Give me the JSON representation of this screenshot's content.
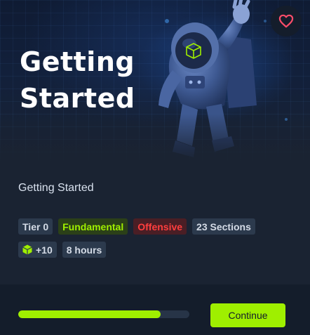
{
  "hero": {
    "title_line1": "Getting",
    "title_line2": "Started"
  },
  "favorite": {
    "icon": "heart-icon",
    "color": "#ff4d6a"
  },
  "module": {
    "name": "Getting Started",
    "tags_row1": [
      {
        "label": "Tier 0",
        "kind": "tier"
      },
      {
        "label": "Fundamental",
        "kind": "difficulty",
        "color": "#9fef00"
      },
      {
        "label": "Offensive",
        "kind": "type",
        "color": "#ff3e3e"
      },
      {
        "label": "23 Sections",
        "kind": "sections"
      }
    ],
    "tags_row2": [
      {
        "label": "+10",
        "kind": "cubes",
        "icon": "cube-icon",
        "color": "#9fef00"
      },
      {
        "label": "8 hours",
        "kind": "duration"
      }
    ]
  },
  "footer": {
    "progress": 0.83,
    "progress_color": "#9fef00",
    "continue_label": "Continue"
  }
}
